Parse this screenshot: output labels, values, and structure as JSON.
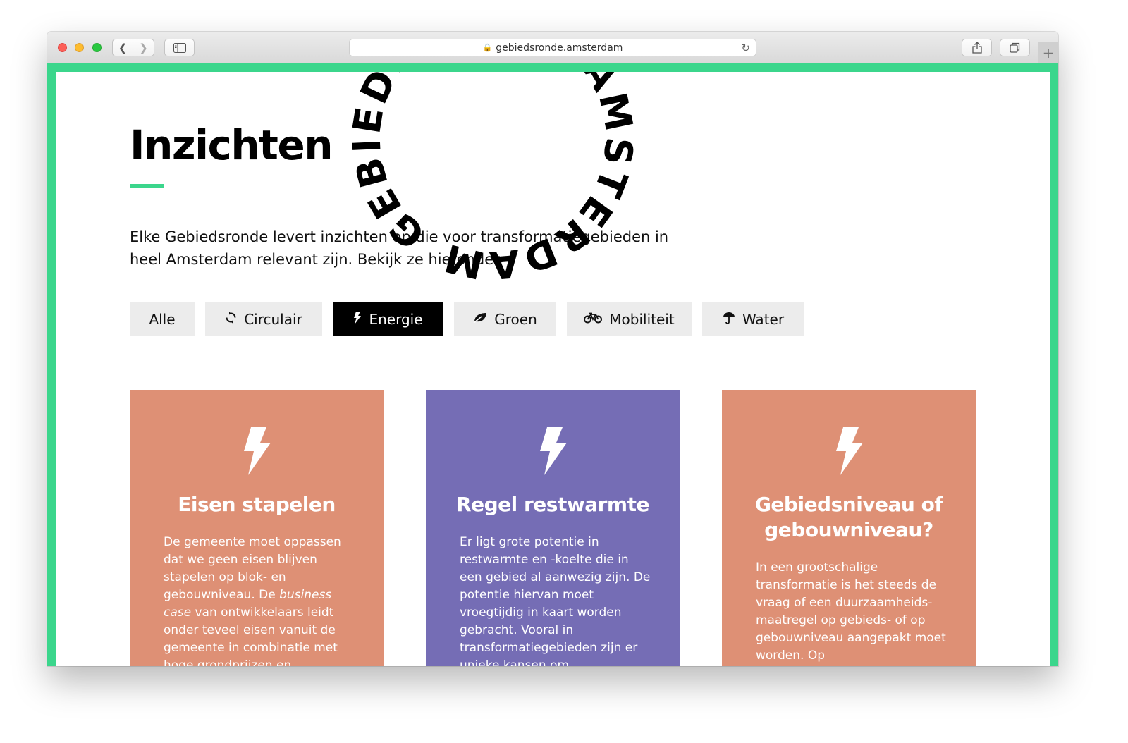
{
  "browser": {
    "url": "gebiedsronde.amsterdam",
    "new_tab_label": "+"
  },
  "logo": {
    "circular_text": "GEBIEDSRONDE AMSTERDAM"
  },
  "page": {
    "title": "Inzichten",
    "intro": "Elke Gebiedsronde levert inzichten op die voor transformatiegebieden in heel Amsterdam relevant zijn. Bekijk ze hieronder."
  },
  "filters": [
    {
      "label": "Alle",
      "icon": "",
      "active": false
    },
    {
      "label": "Circulair",
      "icon": "recycle-icon",
      "active": false
    },
    {
      "label": "Energie",
      "icon": "bolt-icon",
      "active": true
    },
    {
      "label": "Groen",
      "icon": "leaf-icon",
      "active": false
    },
    {
      "label": "Mobiliteit",
      "icon": "bicycle-icon",
      "active": false
    },
    {
      "label": "Water",
      "icon": "umbrella-icon",
      "active": false
    }
  ],
  "cards": [
    {
      "icon": "bolt-icon",
      "color": "#de9075",
      "title": "Eisen stapelen",
      "body_before": "De gemeente moet oppassen dat we geen eisen blijven stapelen op blok- en gebouwniveau. De ",
      "body_em": "business case",
      "body_after": " van ontwikkelaars leidt onder teveel eisen vanuit de gemeente in combinatie met hoge grondprijzen en"
    },
    {
      "icon": "bolt-icon",
      "color": "#756db5",
      "title": "Regel restwarmte",
      "body": "Er ligt grote potentie in restwarmte en -koelte die in een gebied al aanwezig zijn. De potentie hiervan moet vroegtijdig in kaart worden gebracht. Vooral in transformatiegebieden zijn er unieke kansen om"
    },
    {
      "icon": "bolt-icon",
      "color": "#de9075",
      "title": "Gebiedsniveau of gebouwniveau?",
      "body": "In een grootschalige transformatie is het steeds de vraag of een duurzaamheids-maatregel op gebieds- of op gebouwniveau aangepakt moet worden. Op"
    }
  ],
  "colors": {
    "accent": "#3bd68c",
    "active_filter": "#000000"
  }
}
